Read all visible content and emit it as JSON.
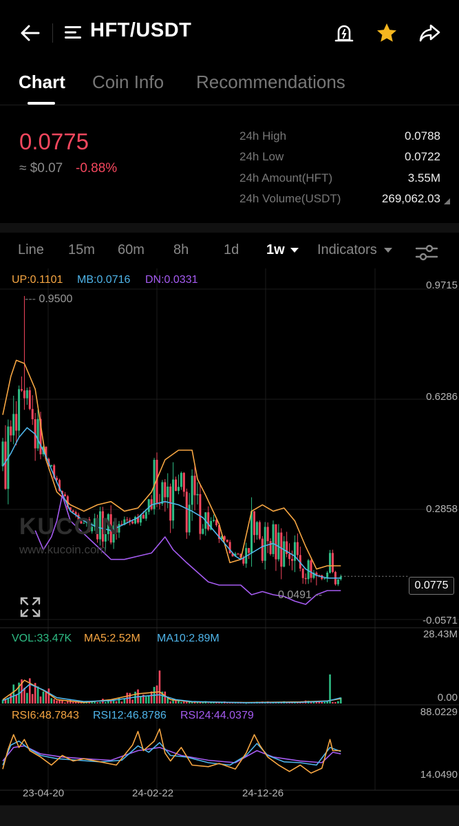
{
  "header": {
    "pair": "HFT/USDT"
  },
  "tabs": [
    {
      "label": "Chart"
    },
    {
      "label": "Coin Info"
    },
    {
      "label": "Recommendations"
    }
  ],
  "ticker": {
    "price": "0.0775",
    "usd": "≈ $0.07",
    "change": "-0.88%",
    "stats": [
      {
        "label": "24h High",
        "value": "0.0788"
      },
      {
        "label": "24h Low",
        "value": "0.0722"
      },
      {
        "label": "24h Amount(HFT)",
        "value": "3.55M"
      },
      {
        "label": "24h Volume(USDT)",
        "value": "269,062.03"
      }
    ]
  },
  "timeframes": [
    {
      "label": "Line"
    },
    {
      "label": "15m"
    },
    {
      "label": "60m"
    },
    {
      "label": "8h"
    },
    {
      "label": "1d"
    },
    {
      "label": "1w"
    }
  ],
  "indicators_label": "Indicators",
  "legends": {
    "up": "UP:0.1101",
    "mb": "MB:0.0716",
    "dn": "DN:0.0331",
    "vol": "VOL:33.47K",
    "ma5": "MA5:2.52M",
    "ma10": "MA10:2.89M",
    "rsi6": "RSI6:48.7843",
    "rsi12": "RSI12:46.8786",
    "rsi24": "RSI24:44.0379"
  },
  "axis": {
    "price_ticks": [
      "0.9715",
      "0.6286",
      "0.2858",
      "-0.0571"
    ],
    "vol_ticks": [
      "28.43M",
      "0.00"
    ],
    "rsi_ticks": [
      "88.0229",
      "14.0490"
    ],
    "dates": [
      "23-04-20",
      "24-02-22",
      "24-12-26"
    ]
  },
  "markers": {
    "high": "0.9500",
    "low": "0.0491",
    "current": "0.0775"
  },
  "watermark": {
    "logo": "KUCOIN",
    "url": "www.kucoin.com"
  },
  "colors": {
    "up": "#2ebd85",
    "down": "#f5475e",
    "boll_up": "#f7a642",
    "boll_mb": "#4fb5ea",
    "boll_dn": "#a55bf1"
  },
  "chart_data": {
    "type": "candlestick",
    "weeks": 126,
    "ylim": [
      -0.0571,
      0.9715
    ],
    "grid": true,
    "bollinger": {
      "up": [
        [
          0,
          0.58
        ],
        [
          3,
          0.7
        ],
        [
          5,
          0.75
        ],
        [
          8,
          0.74
        ],
        [
          12,
          0.66
        ],
        [
          16,
          0.44
        ],
        [
          20,
          0.34
        ],
        [
          25,
          0.3
        ],
        [
          30,
          0.28
        ],
        [
          35,
          0.3
        ],
        [
          40,
          0.31
        ],
        [
          45,
          0.28
        ],
        [
          50,
          0.29
        ],
        [
          55,
          0.34
        ],
        [
          60,
          0.44
        ],
        [
          65,
          0.47
        ],
        [
          70,
          0.47
        ],
        [
          72,
          0.38
        ],
        [
          75,
          0.33
        ],
        [
          80,
          0.24
        ],
        [
          84,
          0.12
        ],
        [
          88,
          0.13
        ],
        [
          92,
          0.28
        ],
        [
          96,
          0.3
        ],
        [
          100,
          0.28
        ],
        [
          104,
          0.29
        ],
        [
          108,
          0.25
        ],
        [
          112,
          0.17
        ],
        [
          116,
          0.1
        ],
        [
          120,
          0.11
        ],
        [
          125,
          0.11
        ]
      ],
      "mb": [
        [
          0,
          0.42
        ],
        [
          3,
          0.46
        ],
        [
          6,
          0.51
        ],
        [
          9,
          0.54
        ],
        [
          12,
          0.52
        ],
        [
          16,
          0.45
        ],
        [
          20,
          0.37
        ],
        [
          25,
          0.28
        ],
        [
          30,
          0.25
        ],
        [
          35,
          0.23
        ],
        [
          40,
          0.22
        ],
        [
          45,
          0.24
        ],
        [
          50,
          0.26
        ],
        [
          55,
          0.3
        ],
        [
          60,
          0.31
        ],
        [
          65,
          0.3
        ],
        [
          70,
          0.28
        ],
        [
          74,
          0.26
        ],
        [
          78,
          0.22
        ],
        [
          82,
          0.18
        ],
        [
          86,
          0.14
        ],
        [
          88,
          0.13
        ],
        [
          92,
          0.15
        ],
        [
          96,
          0.17
        ],
        [
          100,
          0.18
        ],
        [
          104,
          0.16
        ],
        [
          108,
          0.14
        ],
        [
          112,
          0.1
        ],
        [
          116,
          0.08
        ],
        [
          120,
          0.072
        ],
        [
          125,
          0.072
        ]
      ],
      "dn": [
        [
          12,
          0.22
        ],
        [
          15,
          0.16
        ],
        [
          18,
          0.2
        ],
        [
          20,
          0.25
        ],
        [
          22,
          0.33
        ],
        [
          25,
          0.25
        ],
        [
          30,
          0.21
        ],
        [
          35,
          0.17
        ],
        [
          40,
          0.13
        ],
        [
          45,
          0.13
        ],
        [
          50,
          0.14
        ],
        [
          55,
          0.15
        ],
        [
          60,
          0.2
        ],
        [
          63,
          0.16
        ],
        [
          68,
          0.12
        ],
        [
          72,
          0.09
        ],
        [
          76,
          0.06
        ],
        [
          80,
          0.05
        ],
        [
          84,
          0.05
        ],
        [
          88,
          0.05
        ],
        [
          92,
          0.02
        ],
        [
          96,
          0.03
        ],
        [
          100,
          0.02
        ],
        [
          104,
          0.015
        ],
        [
          108,
          0.0
        ],
        [
          112,
          -0.01
        ],
        [
          116,
          0.02
        ],
        [
          120,
          0.033
        ],
        [
          125,
          0.033
        ]
      ]
    },
    "volume_ylim": [
      0,
      28.43
    ],
    "volume_ma": {
      "ma5": [
        [
          0,
          2
        ],
        [
          5,
          7
        ],
        [
          8,
          12
        ],
        [
          12,
          9
        ],
        [
          16,
          6
        ],
        [
          20,
          2
        ],
        [
          30,
          0.5
        ],
        [
          40,
          2
        ],
        [
          50,
          5
        ],
        [
          58,
          6
        ],
        [
          62,
          2
        ],
        [
          70,
          0.8
        ],
        [
          90,
          0.5
        ],
        [
          110,
          0.8
        ],
        [
          120,
          1.3
        ],
        [
          125,
          2.5
        ]
      ],
      "ma10": [
        [
          0,
          1.5
        ],
        [
          6,
          5
        ],
        [
          10,
          10
        ],
        [
          15,
          7
        ],
        [
          20,
          3
        ],
        [
          30,
          1
        ],
        [
          40,
          1.5
        ],
        [
          50,
          3.5
        ],
        [
          58,
          4.5
        ],
        [
          64,
          2
        ],
        [
          70,
          1
        ],
        [
          90,
          0.4
        ],
        [
          110,
          0.6
        ],
        [
          120,
          1.2
        ],
        [
          125,
          2.9
        ]
      ]
    },
    "rsi_ylim": [
      14.049,
      88.0229
    ],
    "rsi": {
      "rsi6": [
        [
          0,
          25
        ],
        [
          2,
          50
        ],
        [
          4,
          68
        ],
        [
          6,
          52
        ],
        [
          8,
          62
        ],
        [
          10,
          48
        ],
        [
          14,
          40
        ],
        [
          18,
          30
        ],
        [
          22,
          42
        ],
        [
          26,
          35
        ],
        [
          30,
          38
        ],
        [
          36,
          34
        ],
        [
          42,
          30
        ],
        [
          48,
          55
        ],
        [
          50,
          72
        ],
        [
          52,
          48
        ],
        [
          56,
          60
        ],
        [
          58,
          75
        ],
        [
          60,
          45
        ],
        [
          62,
          35
        ],
        [
          66,
          52
        ],
        [
          70,
          30
        ],
        [
          76,
          28
        ],
        [
          80,
          32
        ],
        [
          86,
          25
        ],
        [
          90,
          45
        ],
        [
          93,
          68
        ],
        [
          95,
          55
        ],
        [
          98,
          40
        ],
        [
          102,
          30
        ],
        [
          106,
          22
        ],
        [
          110,
          30
        ],
        [
          114,
          20
        ],
        [
          118,
          26
        ],
        [
          121,
          62
        ],
        [
          122,
          48
        ],
        [
          125,
          48
        ]
      ],
      "rsi12": [
        [
          0,
          30
        ],
        [
          3,
          55
        ],
        [
          6,
          60
        ],
        [
          9,
          52
        ],
        [
          14,
          42
        ],
        [
          20,
          38
        ],
        [
          28,
          36
        ],
        [
          36,
          34
        ],
        [
          44,
          36
        ],
        [
          50,
          54
        ],
        [
          54,
          46
        ],
        [
          58,
          58
        ],
        [
          62,
          42
        ],
        [
          68,
          40
        ],
        [
          76,
          33
        ],
        [
          84,
          30
        ],
        [
          90,
          42
        ],
        [
          94,
          57
        ],
        [
          98,
          42
        ],
        [
          104,
          34
        ],
        [
          110,
          33
        ],
        [
          116,
          30
        ],
        [
          121,
          52
        ],
        [
          125,
          47
        ]
      ],
      "rsi24": [
        [
          0,
          35
        ],
        [
          4,
          52
        ],
        [
          8,
          54
        ],
        [
          14,
          44
        ],
        [
          22,
          40
        ],
        [
          30,
          38
        ],
        [
          40,
          36
        ],
        [
          50,
          48
        ],
        [
          58,
          52
        ],
        [
          66,
          42
        ],
        [
          76,
          36
        ],
        [
          86,
          33
        ],
        [
          94,
          48
        ],
        [
          100,
          40
        ],
        [
          110,
          35
        ],
        [
          118,
          33
        ],
        [
          122,
          46
        ],
        [
          125,
          44
        ]
      ]
    }
  }
}
